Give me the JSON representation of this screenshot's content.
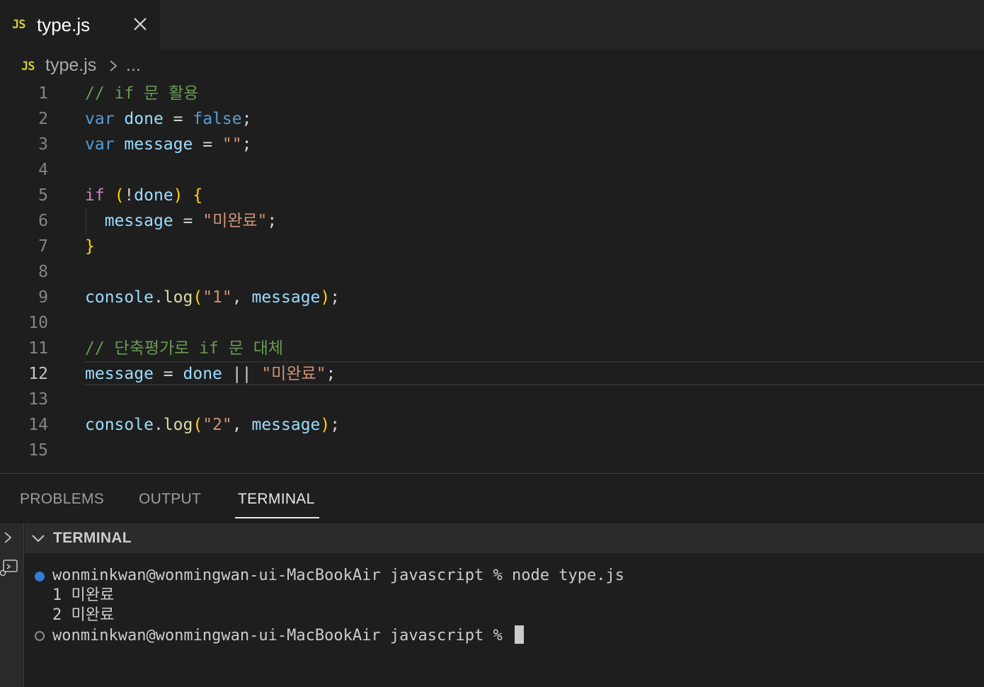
{
  "editor_tab": {
    "icon": "JS",
    "label": "type.js",
    "close_icon": "close-icon"
  },
  "breadcrumb": {
    "icon": "JS",
    "file": "type.js",
    "separator_icon": "chevron-right-icon",
    "more": "..."
  },
  "code_lines": [
    {
      "n": "1",
      "text": "// if 문 활용"
    },
    {
      "n": "2",
      "text": "var done = false;"
    },
    {
      "n": "3",
      "text": "var message = \"\";"
    },
    {
      "n": "4",
      "text": ""
    },
    {
      "n": "5",
      "text": "if (!done) {"
    },
    {
      "n": "6",
      "text": "  message = \"미완료\";"
    },
    {
      "n": "7",
      "text": "}"
    },
    {
      "n": "8",
      "text": ""
    },
    {
      "n": "9",
      "text": "console.log(\"1\", message);"
    },
    {
      "n": "10",
      "text": ""
    },
    {
      "n": "11",
      "text": "// 단축평가로 if 문 대체"
    },
    {
      "n": "12",
      "text": "message = done || \"미완료\";"
    },
    {
      "n": "13",
      "text": ""
    },
    {
      "n": "14",
      "text": "console.log(\"2\", message);"
    },
    {
      "n": "15",
      "text": ""
    }
  ],
  "active_line": "12",
  "panel": {
    "tabs": [
      "PROBLEMS",
      "OUTPUT",
      "TERMINAL"
    ],
    "active_tab": "TERMINAL",
    "terminal_header": "TERMINAL",
    "terminal_lines": [
      {
        "status": "success",
        "text": "wonminkwan@wonmingwan-ui-MacBookAir javascript % node type.js"
      },
      {
        "status": "",
        "text": "1 미완료"
      },
      {
        "status": "",
        "text": "2 미완료"
      },
      {
        "status": "idle",
        "text": "wonminkwan@wonmingwan-ui-MacBookAir javascript % "
      }
    ]
  },
  "colors": {
    "background": "#1e1e1e",
    "js_icon": "#cbcb41",
    "comment": "#6a9955",
    "keyword": "#569cd6",
    "control": "#c586c0",
    "variable": "#9cdcfe",
    "string": "#ce9178",
    "function": "#dcdcaa",
    "brace": "#ffd700",
    "success_dot": "#3794ff"
  }
}
